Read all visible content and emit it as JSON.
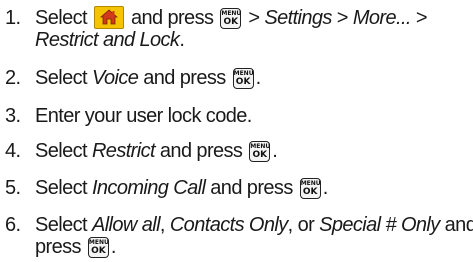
{
  "steps": [
    {
      "number": "1.",
      "a": "Select",
      "b": "and press",
      "c": "> ",
      "d": "Settings",
      "e": " > ",
      "f": "More...",
      "g": " >",
      "h": "Restrict and Lock",
      "i": "."
    },
    {
      "number": "2.",
      "a": "Select ",
      "b": "Voice",
      "c": " and press",
      "d": "."
    },
    {
      "number": "3.",
      "a": "Enter your user lock code."
    },
    {
      "number": "4.",
      "a": "Select ",
      "b": "Restrict",
      "c": " and press",
      "d": "."
    },
    {
      "number": "5.",
      "a": "Select ",
      "b": "Incoming Call",
      "c": " and press",
      "d": "."
    },
    {
      "number": "6.",
      "a": "Select ",
      "b": "Allow all",
      "c": ", ",
      "d": "Contacts Only",
      "e": ", or ",
      "f": "Special # Only",
      "g": " and",
      "h": "press",
      "i": "."
    }
  ],
  "key": {
    "top": "MENU",
    "bottom": "OK"
  },
  "icons": {
    "home": "home-icon",
    "menu_ok": "menu-ok-key-icon"
  },
  "colors": {
    "home_bg": "#f5c400",
    "home_house": "#d03a1a"
  }
}
